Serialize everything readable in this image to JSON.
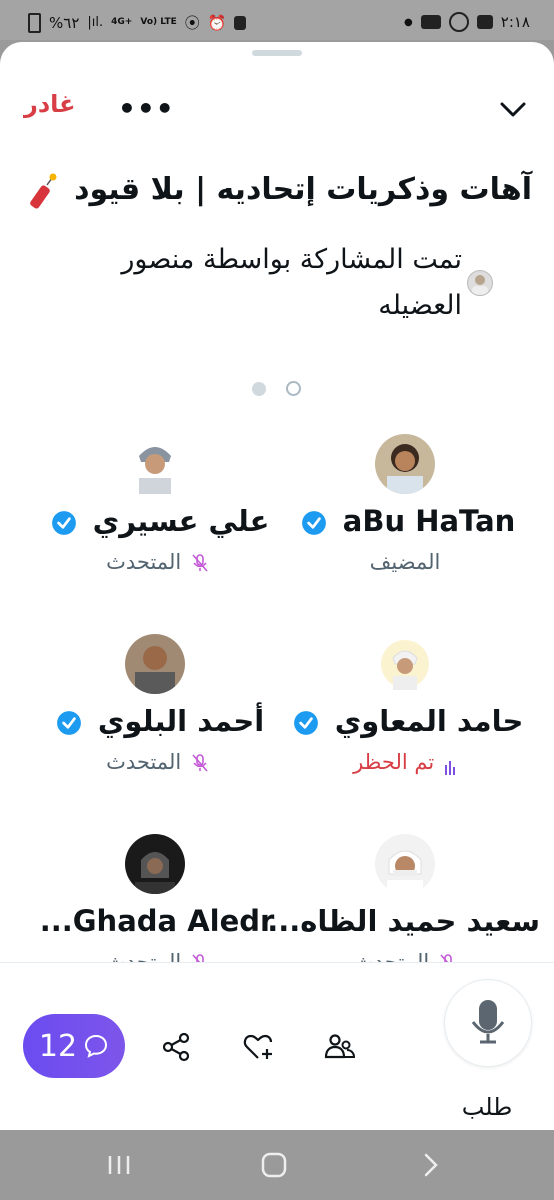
{
  "status_bar": {
    "battery": "%٦٢",
    "network": "4G+",
    "volte": "Vo) LTE",
    "time": "٢:١٨"
  },
  "header": {
    "leave_label": "غادر",
    "more_label": "•••"
  },
  "space": {
    "title": "آهات وذكريات إتحاديه | بلا قيود",
    "shared_by": "تمت المشاركة بواسطة منصور العضيله"
  },
  "speakers": [
    {
      "name": "aBu HaTan",
      "role": "المضيف",
      "verified": true,
      "role_style": "normal"
    },
    {
      "name": "علي عسيري",
      "role": "المتحدث",
      "verified": true,
      "role_style": "muted"
    },
    {
      "name": "حامد المعاوي",
      "role": "تم الحظر",
      "verified": true,
      "role_style": "blocked"
    },
    {
      "name": "أحمد البلوي",
      "role": "المتحدث",
      "verified": true,
      "role_style": "muted"
    },
    {
      "name": "سعيد حميد الظاه...",
      "role": "المتحدث",
      "verified": false,
      "role_style": "muted"
    },
    {
      "name": "Ghada Aledr...",
      "role": "المتحدث",
      "verified": false,
      "role_style": "muted"
    }
  ],
  "bottom_bar": {
    "chat_count": "12",
    "request_label": "طلب"
  },
  "colors": {
    "accent_purple": "#6b4cf0",
    "leave_red": "#d83e45",
    "verified_blue": "#1d9bf0"
  }
}
